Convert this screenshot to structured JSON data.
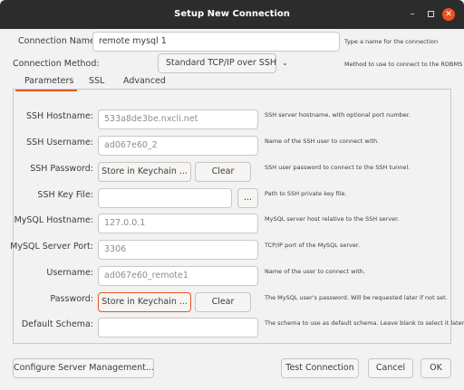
{
  "window": {
    "title": "Setup New Connection"
  },
  "top": {
    "connection_name_label": "Connection Name:",
    "connection_name_value": "remote mysql 1",
    "connection_name_hint": "Type a name for the connection",
    "connection_method_label": "Connection Method:",
    "connection_method_value": "Standard TCP/IP over SSH",
    "connection_method_hint": "Method to use to connect to the RDBMS"
  },
  "tabs": [
    {
      "label": "Parameters"
    },
    {
      "label": "SSL"
    },
    {
      "label": "Advanced"
    }
  ],
  "fields": {
    "ssh_hostname": {
      "label": "SSH Hostname:",
      "placeholder": "533a8de3be.nxcli.net",
      "hint": "SSH server hostname, with  optional port number."
    },
    "ssh_username": {
      "label": "SSH Username:",
      "placeholder": "ad067e60_2",
      "hint": "Name of the SSH user to connect with."
    },
    "ssh_password": {
      "label": "SSH Password:",
      "store_label": "Store in Keychain ...",
      "clear_label": "Clear",
      "hint": "SSH user password to connect to the SSH tunnel."
    },
    "ssh_key_file": {
      "label": "SSH Key File:",
      "value": "",
      "browse_label": "...",
      "hint": "Path to SSH private key file."
    },
    "mysql_hostname": {
      "label": "MySQL Hostname:",
      "placeholder": "127.0.0.1",
      "hint": "MySQL server host relative to the SSH server."
    },
    "mysql_port": {
      "label": "MySQL Server Port:",
      "placeholder": "3306",
      "hint": "TCP/IP port of the MySQL server."
    },
    "username": {
      "label": "Username:",
      "placeholder": "ad067e60_remote1",
      "hint": "Name of the user to connect with."
    },
    "password": {
      "label": "Password:",
      "store_label": "Store in Keychain ...",
      "clear_label": "Clear",
      "hint": "The MySQL user's password. Will be requested later if not set."
    },
    "default_schema": {
      "label": "Default Schema:",
      "value": "",
      "hint": "The schema to use as default schema. Leave blank to select it later."
    }
  },
  "footer": {
    "configure_label": "Configure Server Management...",
    "test_label": "Test Connection",
    "cancel_label": "Cancel",
    "ok_label": "OK"
  },
  "colors": {
    "accent": "#e95420",
    "titlebar": "#2c2c2c"
  }
}
